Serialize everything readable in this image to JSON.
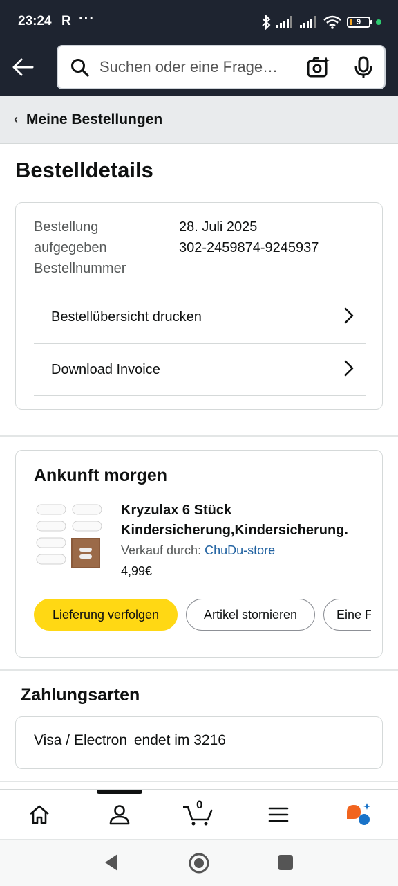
{
  "status_bar": {
    "time": "23:24",
    "carrier_mark": "R",
    "more": "···",
    "battery": "9"
  },
  "search": {
    "placeholder": "Suchen oder eine Frage…"
  },
  "breadcrumb": {
    "label": "Meine Bestellungen"
  },
  "page_title": "Bestelldetails",
  "order": {
    "labels": [
      "Bestellung",
      "aufgegeben",
      "Bestellnummer"
    ],
    "date": "28. Juli 2025",
    "number": "302-2459874-9245937",
    "links": [
      {
        "label": "Bestellübersicht drucken"
      },
      {
        "label": "Download Invoice"
      }
    ]
  },
  "shipment": {
    "heading": "Ankunft morgen",
    "product_title_line1": "Kryzulax 6 Stück",
    "product_title_line2": "Kindersicherung,Kindersicherung.",
    "seller_prefix": "Verkauf durch:",
    "seller_name": "ChuDu-store",
    "price": "4,99€",
    "buttons": {
      "track": "Lieferung verfolgen",
      "cancel": "Artikel stornieren",
      "more": "Eine F"
    }
  },
  "payment": {
    "heading": "Zahlungsarten",
    "method": "Visa / Electron",
    "ending": "endet im 3216"
  },
  "bottom_nav": {
    "cart_count": "0"
  },
  "colors": {
    "header_bg": "#1e2430",
    "primary_button": "#ffd814",
    "link": "#2162a1"
  }
}
